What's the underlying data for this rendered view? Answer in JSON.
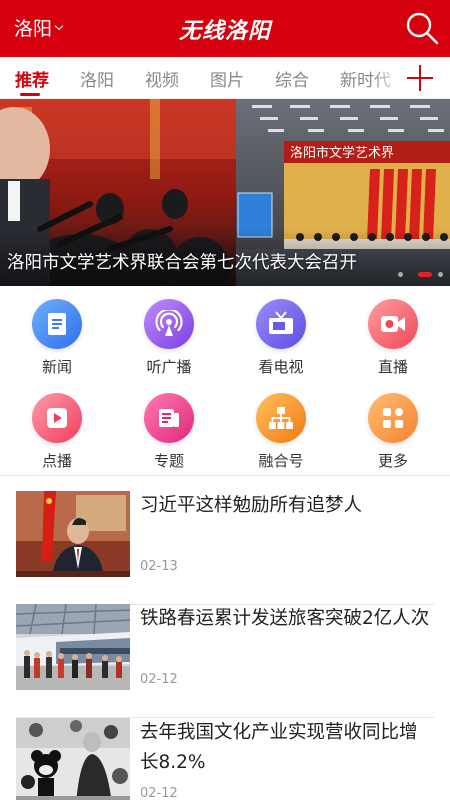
{
  "header": {
    "city": "洛阳",
    "logo_text": "无线洛阳",
    "brand_color": "#d7000f"
  },
  "tabs": [
    {
      "label": "推荐",
      "active": true
    },
    {
      "label": "洛阳",
      "active": false
    },
    {
      "label": "视频",
      "active": false
    },
    {
      "label": "图片",
      "active": false
    },
    {
      "label": "综合",
      "active": false
    },
    {
      "label": "新时代",
      "active": false
    }
  ],
  "banner": {
    "caption": "洛阳市文学艺术界联合会第七次代表大会召开",
    "stage_banner_text": "洛阳市文学艺术界",
    "active_slide": 1
  },
  "quick_grid": [
    {
      "label": "新闻",
      "icon": "news-icon",
      "colors": [
        "#5aa0ff",
        "#2f6fe8"
      ]
    },
    {
      "label": "听广播",
      "icon": "radio-icon",
      "colors": [
        "#b47cff",
        "#7c3fe0"
      ]
    },
    {
      "label": "看电视",
      "icon": "tv-icon",
      "colors": [
        "#8b7cff",
        "#5a4fe0"
      ]
    },
    {
      "label": "直播",
      "icon": "live-icon",
      "colors": [
        "#ff8a8a",
        "#f0485a"
      ]
    },
    {
      "label": "点播",
      "icon": "play-icon",
      "colors": [
        "#ff8a9a",
        "#ee3e5e"
      ]
    },
    {
      "label": "专题",
      "icon": "topic-icon",
      "colors": [
        "#ff6ba8",
        "#e0287a"
      ]
    },
    {
      "label": "融合号",
      "icon": "org-icon",
      "colors": [
        "#ffb347",
        "#f07a10"
      ]
    },
    {
      "label": "更多",
      "icon": "more-grid-icon",
      "colors": [
        "#ffb060",
        "#f58232"
      ]
    }
  ],
  "news": [
    {
      "title": "习近平这样勉励所有追梦人",
      "date": "02-13"
    },
    {
      "title": "铁路春运累计发送旅客突破2亿人次",
      "date": "02-12"
    },
    {
      "title": "去年我国文化产业实现营收同比增长8.2%",
      "date": "02-12"
    }
  ]
}
